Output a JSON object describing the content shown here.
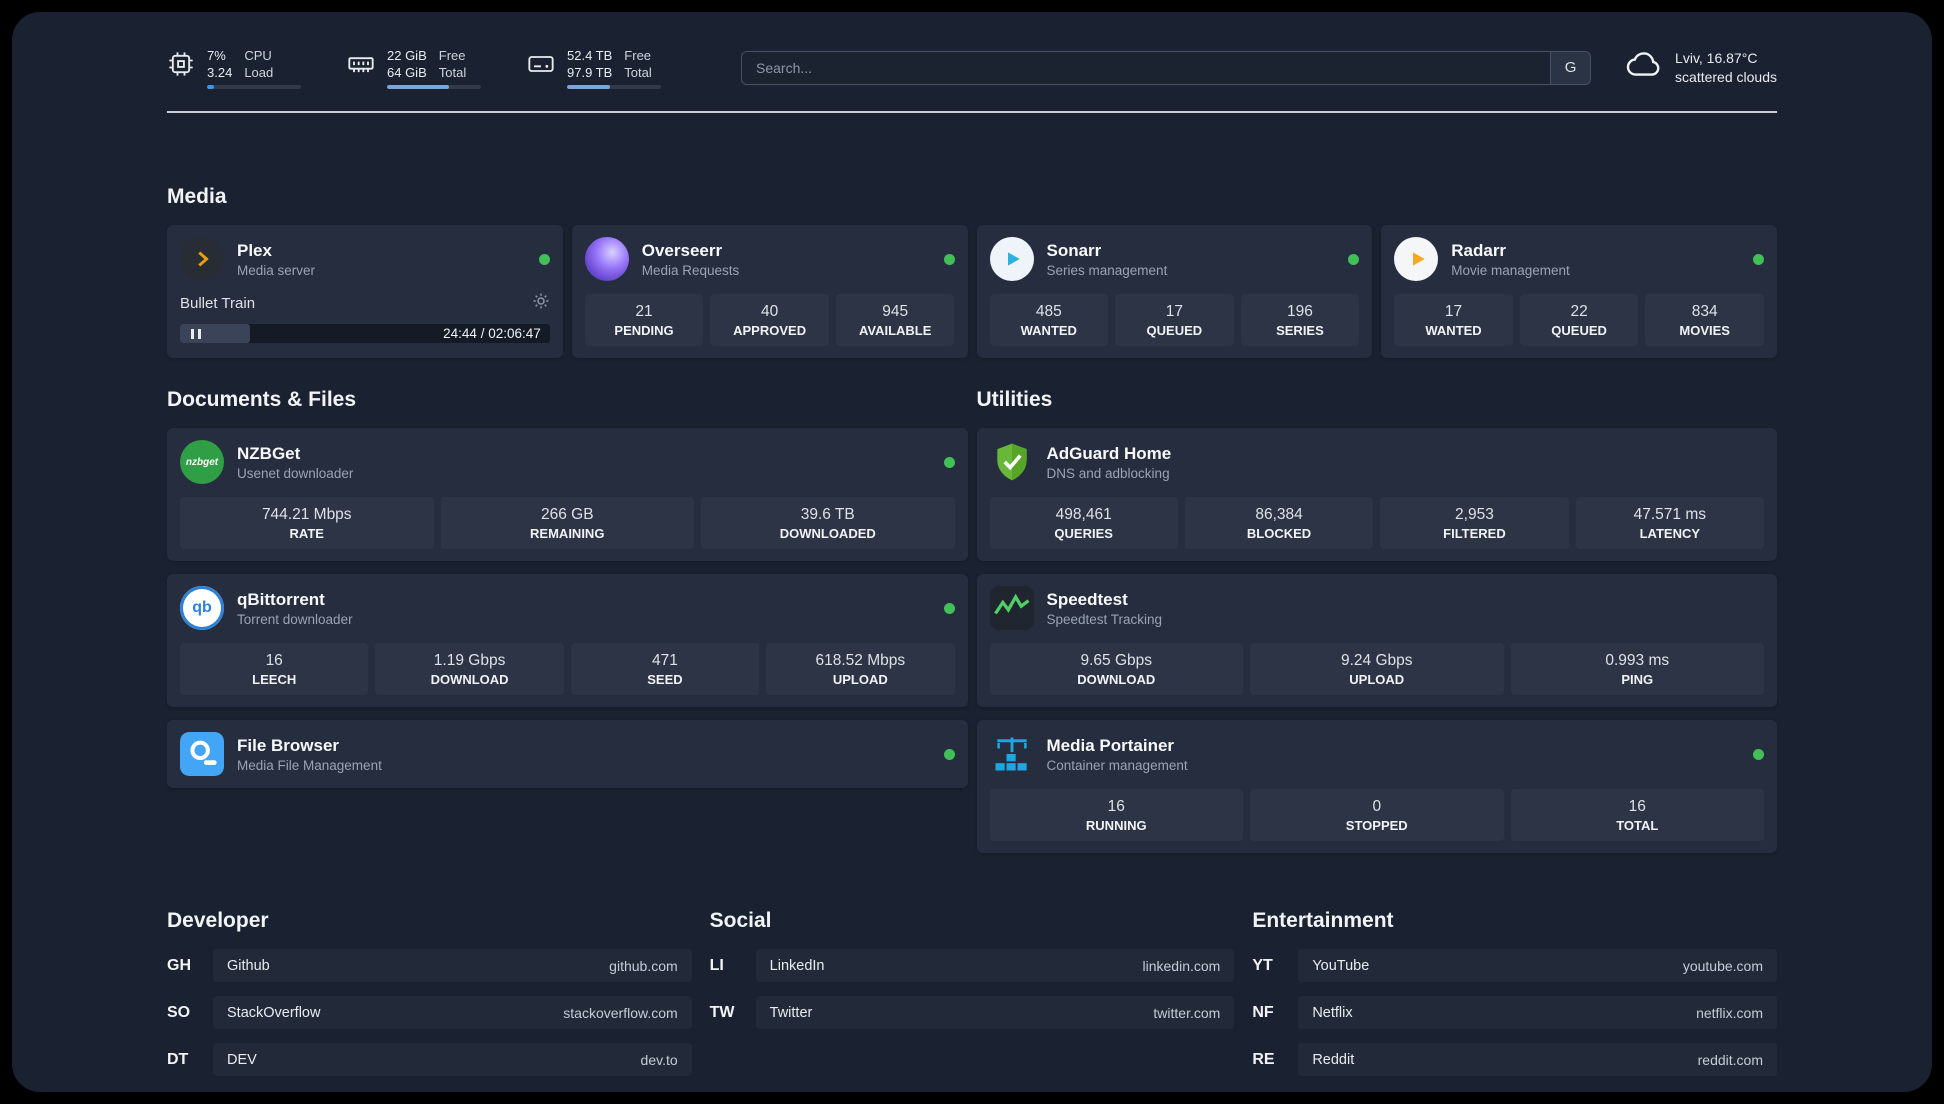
{
  "topbar": {
    "cpu": {
      "value_top": "7%",
      "value_bottom": "3.24",
      "label_top": "CPU",
      "label_bottom": "Load",
      "progress": 7
    },
    "ram": {
      "value_top": "22 GiB",
      "value_bottom": "64 GiB",
      "label_top": "Free",
      "label_bottom": "Total",
      "progress": 66
    },
    "disk": {
      "value_top": "52.4 TB",
      "value_bottom": "97.9 TB",
      "label_top": "Free",
      "label_bottom": "Total",
      "progress": 46
    },
    "search": {
      "placeholder": "Search...",
      "button_label": "G"
    },
    "weather": {
      "location": "Lviv, 16.87°C",
      "condition": "scattered clouds"
    }
  },
  "sections": {
    "media": {
      "title": "Media",
      "cards": [
        {
          "name": "Plex",
          "subtitle": "Media server",
          "icon": "plex-chevron-icon",
          "status": "online",
          "now_playing": {
            "title": "Bullet Train",
            "time": "24:44 / 02:06:47",
            "progress": 19
          }
        },
        {
          "name": "Overseerr",
          "subtitle": "Media Requests",
          "icon": "overseerr-swirl-icon",
          "status": "online",
          "stats": [
            {
              "value": "21",
              "label": "PENDING"
            },
            {
              "value": "40",
              "label": "APPROVED"
            },
            {
              "value": "945",
              "label": "AVAILABLE"
            }
          ]
        },
        {
          "name": "Sonarr",
          "subtitle": "Series management",
          "icon": "sonarr-arrow-icon",
          "status": "online",
          "stats": [
            {
              "value": "485",
              "label": "WANTED"
            },
            {
              "value": "17",
              "label": "QUEUED"
            },
            {
              "value": "196",
              "label": "SERIES"
            }
          ]
        },
        {
          "name": "Radarr",
          "subtitle": "Movie management",
          "icon": "radarr-arrow-icon",
          "status": "online",
          "stats": [
            {
              "value": "17",
              "label": "WANTED"
            },
            {
              "value": "22",
              "label": "QUEUED"
            },
            {
              "value": "834",
              "label": "MOVIES"
            }
          ]
        }
      ]
    },
    "documents": {
      "title": "Documents & Files",
      "cards": [
        {
          "name": "NZBGet",
          "subtitle": "Usenet downloader",
          "icon": "nzbget-icon",
          "status": "online",
          "stats": [
            {
              "value": "744.21 Mbps",
              "label": "RATE"
            },
            {
              "value": "266 GB",
              "label": "REMAINING"
            },
            {
              "value": "39.6 TB",
              "label": "DOWNLOADED"
            }
          ]
        },
        {
          "name": "qBittorrent",
          "subtitle": "Torrent downloader",
          "icon": "qbittorrent-icon",
          "status": "online",
          "stats": [
            {
              "value": "16",
              "label": "LEECH"
            },
            {
              "value": "1.19 Gbps",
              "label": "DOWNLOAD"
            },
            {
              "value": "471",
              "label": "SEED"
            },
            {
              "value": "618.52 Mbps",
              "label": "UPLOAD"
            }
          ]
        },
        {
          "name": "File Browser",
          "subtitle": "Media File Management",
          "icon": "filebrowser-icon",
          "status": "online",
          "stats": []
        }
      ]
    },
    "utilities": {
      "title": "Utilities",
      "cards": [
        {
          "name": "AdGuard Home",
          "subtitle": "DNS and adblocking",
          "icon": "adguard-shield-icon",
          "stats": [
            {
              "value": "498,461",
              "label": "QUERIES"
            },
            {
              "value": "86,384",
              "label": "BLOCKED"
            },
            {
              "value": "2,953",
              "label": "FILTERED"
            },
            {
              "value": "47.571 ms",
              "label": "LATENCY"
            }
          ]
        },
        {
          "name": "Speedtest",
          "subtitle": "Speedtest Tracking",
          "icon": "speedtest-graph-icon",
          "stats": [
            {
              "value": "9.65 Gbps",
              "label": "DOWNLOAD"
            },
            {
              "value": "9.24 Gbps",
              "label": "UPLOAD"
            },
            {
              "value": "0.993 ms",
              "label": "PING"
            }
          ]
        },
        {
          "name": "Media Portainer",
          "subtitle": "Container management",
          "icon": "portainer-crane-icon",
          "status": "online",
          "stats": [
            {
              "value": "16",
              "label": "RUNNING"
            },
            {
              "value": "0",
              "label": "STOPPED"
            },
            {
              "value": "16",
              "label": "TOTAL"
            }
          ]
        }
      ]
    }
  },
  "bookmarks": {
    "developer": {
      "title": "Developer",
      "links": [
        {
          "abbr": "GH",
          "name": "Github",
          "url": "github.com"
        },
        {
          "abbr": "SO",
          "name": "StackOverflow",
          "url": "stackoverflow.com"
        },
        {
          "abbr": "DT",
          "name": "DEV",
          "url": "dev.to"
        }
      ]
    },
    "social": {
      "title": "Social",
      "links": [
        {
          "abbr": "LI",
          "name": "LinkedIn",
          "url": "linkedin.com"
        },
        {
          "abbr": "TW",
          "name": "Twitter",
          "url": "twitter.com"
        }
      ]
    },
    "entertainment": {
      "title": "Entertainment",
      "links": [
        {
          "abbr": "YT",
          "name": "YouTube",
          "url": "youtube.com"
        },
        {
          "abbr": "NF",
          "name": "Netflix",
          "url": "netflix.com"
        },
        {
          "abbr": "RE",
          "name": "Reddit",
          "url": "reddit.com"
        }
      ]
    }
  },
  "colors": {
    "background": "#1a2231",
    "card": "#252d3e",
    "tile": "#2c3446",
    "status_online": "#40c057",
    "accent_blue": "#7aa5d8",
    "plex_gold": "#e5a00d",
    "adguard_green": "#68b738",
    "portainer_blue": "#1ba8e0"
  },
  "icons": {
    "topbar": [
      "cpu-icon",
      "ram-icon",
      "disk-icon",
      "cloud-icon"
    ],
    "plex_player": [
      "pause-icon",
      "gear-icon"
    ]
  }
}
